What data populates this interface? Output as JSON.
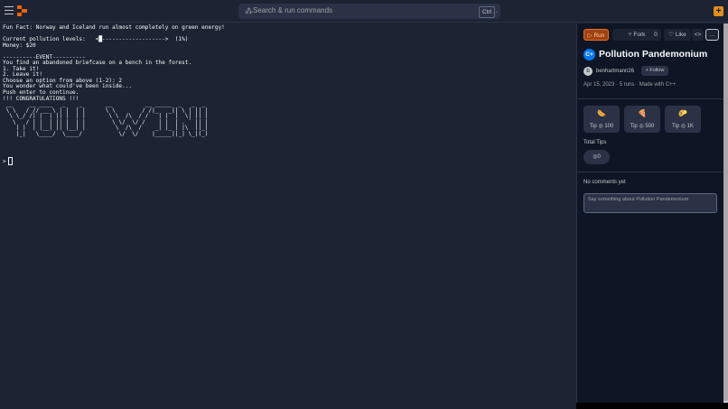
{
  "topbar": {
    "search_placeholder": "Search & run commands",
    "shortcut_key": "Ctrl",
    "shortcut_key2": ".",
    "plus_label": "+"
  },
  "console": {
    "output": "Fun Fact: Norway and Iceland run almost completely on green energy!\n\nCurrent pollution levels:   <█------------------->  (1%)\nMoney: $20\n\n----------EVENT----------\nYou find an abandoned briefcase on a bench in the forest.\n1. Take it!\n2. Leave it!\nChoose an option from above (1-2): 2\nYou wonder what could've been inside...\nPush enter to continue.\n!!! CONGRATULATIONS !!!\n __     __ ____   _    _       __          __ _____  _   _  _\n \\ \\   / // __ \\ | |  | |      \\ \\        / /|_   _|| \\ | || |\n  \\ \\_/ /| |  | || |  | |       \\ \\  /\\  / /   | |  |  \\| || |\n   \\   / | |  | || |  | |        \\ \\/  \\/ /    | |  | . ` || |\n    | |  | |__| || |__| |         \\  /\\  /    _| |_ | |\\  ||_|\n    |_|   \\____/  \\____/           \\/  \\/    |_____||_| \\_|(_)",
    "prompt": ">"
  },
  "panel": {
    "run_label": "Run",
    "fork_label": "Fork",
    "fork_count": "0",
    "like_label": "Like",
    "code_label": "<>",
    "more_label": "···",
    "project_icon_text": "C+",
    "project_title": "Pollution Pandemonium",
    "author_initial": "b",
    "author": "benhartmann26",
    "follow_label": "+ Follow",
    "meta": "Apr 15, 2023 · 5 runs · Made with C++",
    "tips": [
      {
        "icon": "sausage-icon",
        "label": "Tip ◎ 100"
      },
      {
        "icon": "pizza-icon",
        "label": "Tip ◎ 500"
      },
      {
        "icon": "hotdog-icon",
        "label": "Tip ◎ 1K"
      }
    ],
    "total_tips_label": "Total Tips",
    "total_tips_value": "◎0",
    "no_comments": "No comments yet",
    "comment_placeholder": "Say something about Pollution Pandemonium"
  },
  "colors": {
    "accent": "#e48e17",
    "run_bg": "#a2410f",
    "panel_bg": "#0e1525",
    "console_bg": "#1c2333"
  }
}
